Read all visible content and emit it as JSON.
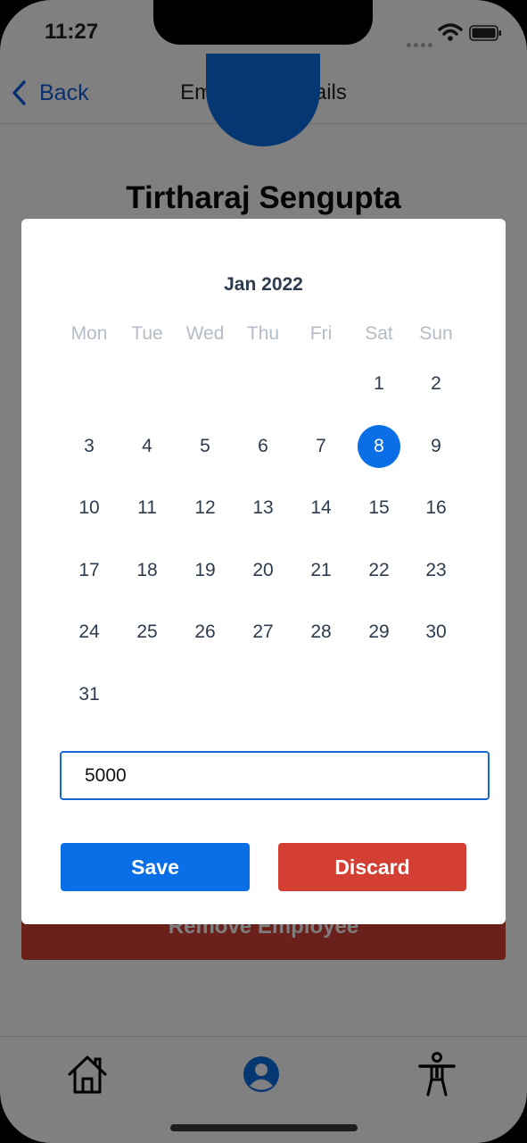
{
  "status_bar": {
    "time": "11:27"
  },
  "nav": {
    "back_label": "Back",
    "title": "Employee Details"
  },
  "employee": {
    "name": "Tirtharaj Sengupta"
  },
  "remove_button_label": "Remove Employee",
  "calendar": {
    "month_title": "Jan 2022",
    "weekdays": [
      "Mon",
      "Tue",
      "Wed",
      "Thu",
      "Fri",
      "Sat",
      "Sun"
    ],
    "first_weekday_index": 5,
    "days_in_month": 31,
    "selected_day": 8,
    "selected_color": "#0a6fe6"
  },
  "amount_input": {
    "value": "5000"
  },
  "actions": {
    "save_label": "Save",
    "discard_label": "Discard"
  },
  "tab_bar": {
    "items": [
      "home-icon",
      "profile-icon",
      "accessibility-icon"
    ],
    "active": "profile-icon"
  },
  "colors": {
    "primary": "#0a6fe6",
    "danger": "#d33f33",
    "overlay": "#808080"
  }
}
